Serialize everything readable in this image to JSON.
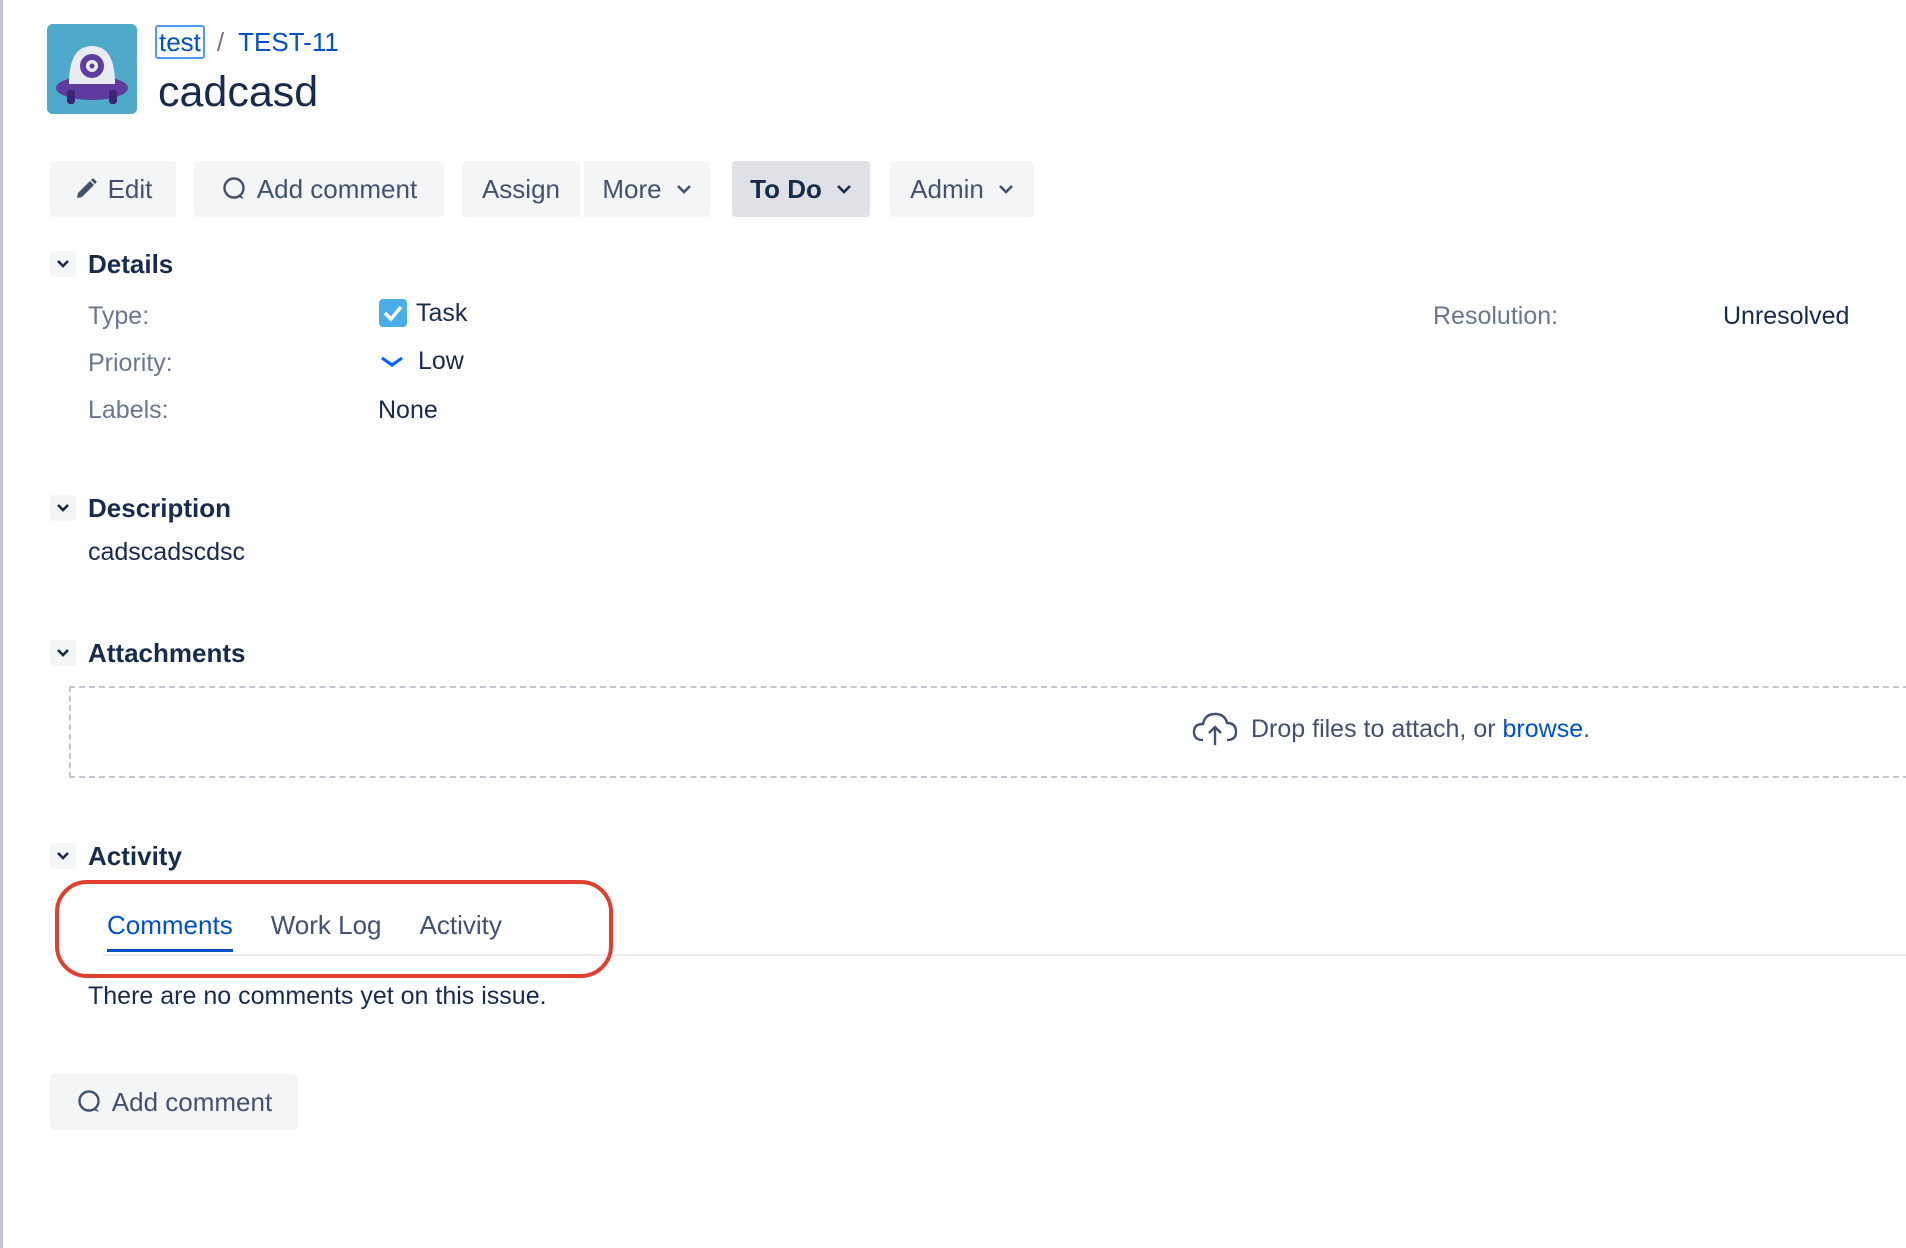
{
  "header": {
    "project": "test",
    "separator": "/",
    "issue_key": "TEST-11",
    "title": "cadcasd",
    "avatar_icon": "project-avatar-icon"
  },
  "toolbar": {
    "edit": "Edit",
    "add_comment": "Add comment",
    "assign": "Assign",
    "more": "More",
    "status": "To Do",
    "admin": "Admin"
  },
  "details": {
    "heading": "Details",
    "type_label": "Type:",
    "type_value": "Task",
    "priority_label": "Priority:",
    "priority_value": "Low",
    "labels_label": "Labels:",
    "labels_value": "None",
    "resolution_label": "Resolution:",
    "resolution_value": "Unresolved"
  },
  "description": {
    "heading": "Description",
    "text": "cadscadscdsc"
  },
  "attachments": {
    "heading": "Attachments",
    "drop_text": "Drop files to attach, or",
    "browse_link": "browse",
    "suffix": "."
  },
  "activity": {
    "heading": "Activity",
    "tabs": [
      "Comments",
      "Work Log",
      "Activity"
    ],
    "active_tab": "Comments",
    "empty_message": "There are no comments yet on this issue.",
    "add_comment": "Add comment"
  },
  "colors": {
    "link": "#0052cc",
    "text": "#172b4d",
    "muted": "#6b778c",
    "button_bg": "#f4f5f7",
    "highlight": "#e0402f"
  }
}
